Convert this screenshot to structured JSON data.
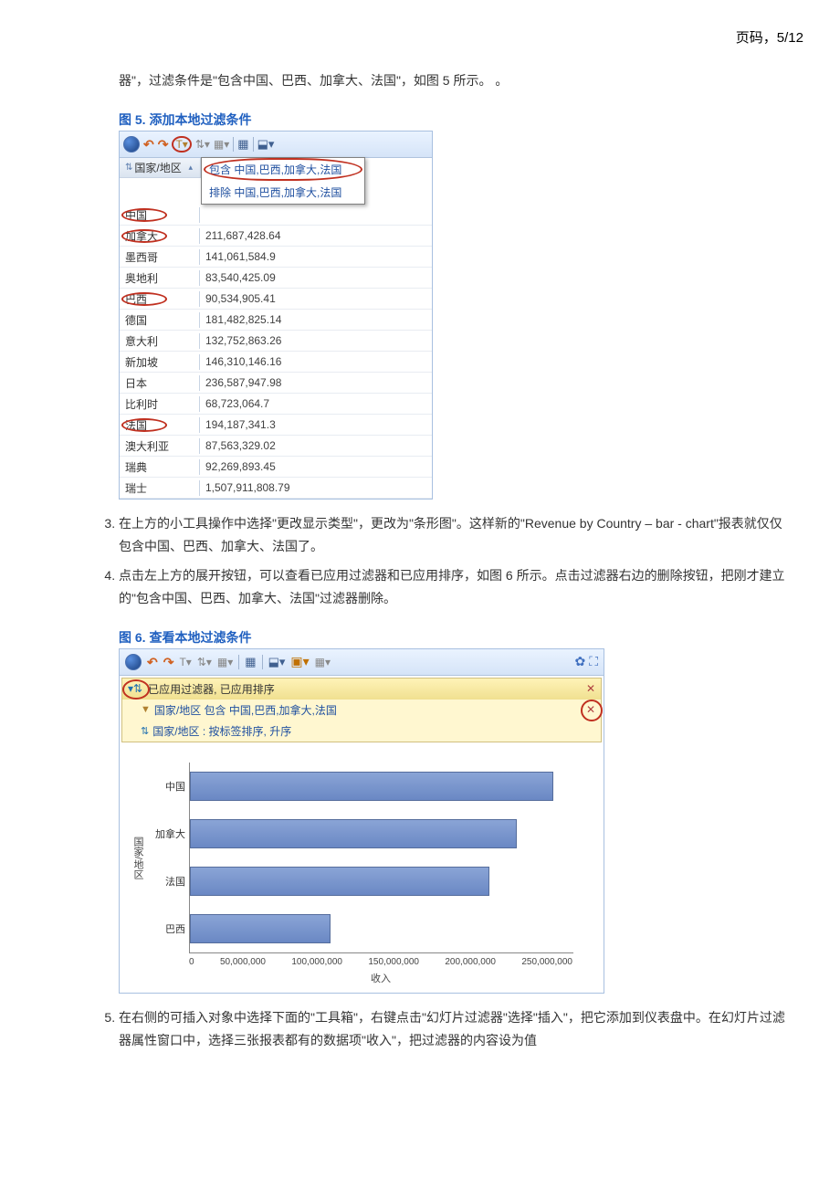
{
  "page_number_label": "页码，5/12",
  "intro_text": "器\"，过滤条件是\"包含中国、巴西、加拿大、法国\"，如图 5 所示。 。",
  "fig5_caption": "图 5. 添加本地过滤条件",
  "fig5": {
    "column_header": "国家/地区",
    "menu_include": "包含 中国,巴西,加拿大,法国",
    "menu_exclude": "排除 中国,巴西,加拿大,法国",
    "rows": [
      {
        "name": "中国",
        "circled": true,
        "value": ""
      },
      {
        "name": "加拿大",
        "circled": true,
        "value": "211,687,428.64"
      },
      {
        "name": "墨西哥",
        "circled": false,
        "value": "141,061,584.9"
      },
      {
        "name": "奥地利",
        "circled": false,
        "value": "83,540,425.09"
      },
      {
        "name": "巴西",
        "circled": true,
        "value": "90,534,905.41"
      },
      {
        "name": "德国",
        "circled": false,
        "value": "181,482,825.14"
      },
      {
        "name": "意大利",
        "circled": false,
        "value": "132,752,863.26"
      },
      {
        "name": "新加坡",
        "circled": false,
        "value": "146,310,146.16"
      },
      {
        "name": "日本",
        "circled": false,
        "value": "236,587,947.98"
      },
      {
        "name": "比利时",
        "circled": false,
        "value": "68,723,064.7"
      },
      {
        "name": "法国",
        "circled": true,
        "value": "194,187,341.3"
      },
      {
        "name": "澳大利亚",
        "circled": false,
        "value": "87,563,329.02"
      },
      {
        "name": "瑞典",
        "circled": false,
        "value": "92,269,893.45"
      },
      {
        "name": "瑞士",
        "circled": false,
        "value": "1,507,911,808.79"
      }
    ]
  },
  "step3_text": "在上方的小工具操作中选择\"更改显示类型\"，更改为\"条形图\"。这样新的\"Revenue by Country – bar - chart\"报表就仅仅包含中国、巴西、加拿大、法国了。",
  "step4_text": "点击左上方的展开按钮，可以查看已应用过滤器和已应用排序，如图 6 所示。点击过滤器右边的删除按钮，把刚才建立的\"包含中国、巴西、加拿大、法国\"过滤器删除。",
  "fig6_caption": "图 6. 查看本地过滤条件",
  "fig6": {
    "panel_title": "已应用过滤器, 已应用排序",
    "filter_row": "国家/地区 包含 中国,巴西,加拿大,法国",
    "sort_row": "国家/地区 : 按标签排序, 升序",
    "ylabel": "国家/地区",
    "xlabel": "收入",
    "xticks": [
      "0",
      "50,000,000",
      "100,000,000",
      "150,000,000",
      "200,000,000",
      "250,000,000"
    ]
  },
  "step5_text": "在右侧的可插入对象中选择下面的\"工具箱\"，右键点击\"幻灯片过滤器\"选择\"插入\"，把它添加到仪表盘中。在幻灯片过滤器属性窗口中，选择三张报表都有的数据项\"收入\"，把过滤器的内容设为值",
  "chart_data": {
    "type": "bar",
    "orientation": "horizontal",
    "categories": [
      "中国",
      "加拿大",
      "法国",
      "巴西"
    ],
    "values": [
      236000000,
      211687429,
      194187341,
      90534905
    ],
    "xlabel": "收入",
    "ylabel": "国家/地区",
    "xlim": [
      0,
      250000000
    ],
    "xticks": [
      0,
      50000000,
      100000000,
      150000000,
      200000000,
      250000000
    ]
  }
}
